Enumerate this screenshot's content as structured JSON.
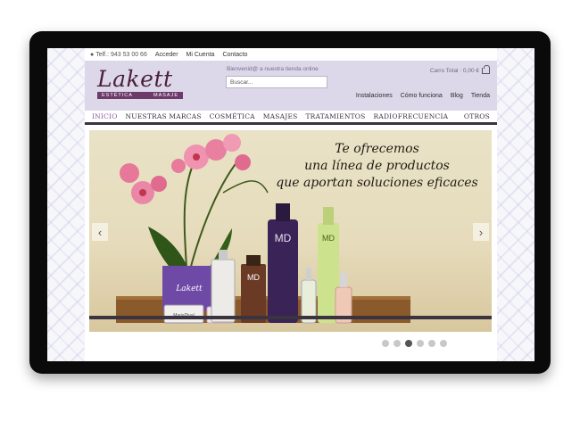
{
  "topbar": {
    "phone": "Telf.: 943 53 00 66",
    "links": [
      "Acceder",
      "Mi Cuenta",
      "Contacto"
    ]
  },
  "header": {
    "logo_title": "Lakett",
    "logo_sub_left": "ESTÉTICA",
    "logo_sub_right": "MASAJE",
    "welcome": "Bienvenid@ a nuestra tienda online",
    "search_placeholder": "Buscar...",
    "cart": "Carro Total : 0,00 €",
    "links": [
      "Instalaciones",
      "Cómo funciona",
      "Blog",
      "Tienda"
    ]
  },
  "nav": {
    "items": [
      "INICIO",
      "NUESTRAS MARCAS",
      "COSMÉTICA",
      "MASAJES",
      "TRATAMIENTOS",
      "RADIOFRECUENCIA"
    ],
    "right_item": "OTROS"
  },
  "slider": {
    "line1": "Te ofrecemos",
    "line2": "una línea de productos",
    "line3": "que aportan soluciones eficaces",
    "prev": "‹",
    "next": "›",
    "box_label": "Lakett",
    "bottle_md": "MD",
    "jar_label": "MariaDival",
    "dots_count": 6,
    "active_dot": 3
  },
  "colors": {
    "header_bg": "#dcd8ea",
    "nav_active": "#8f57a6",
    "logo": "#4a1f3a"
  }
}
